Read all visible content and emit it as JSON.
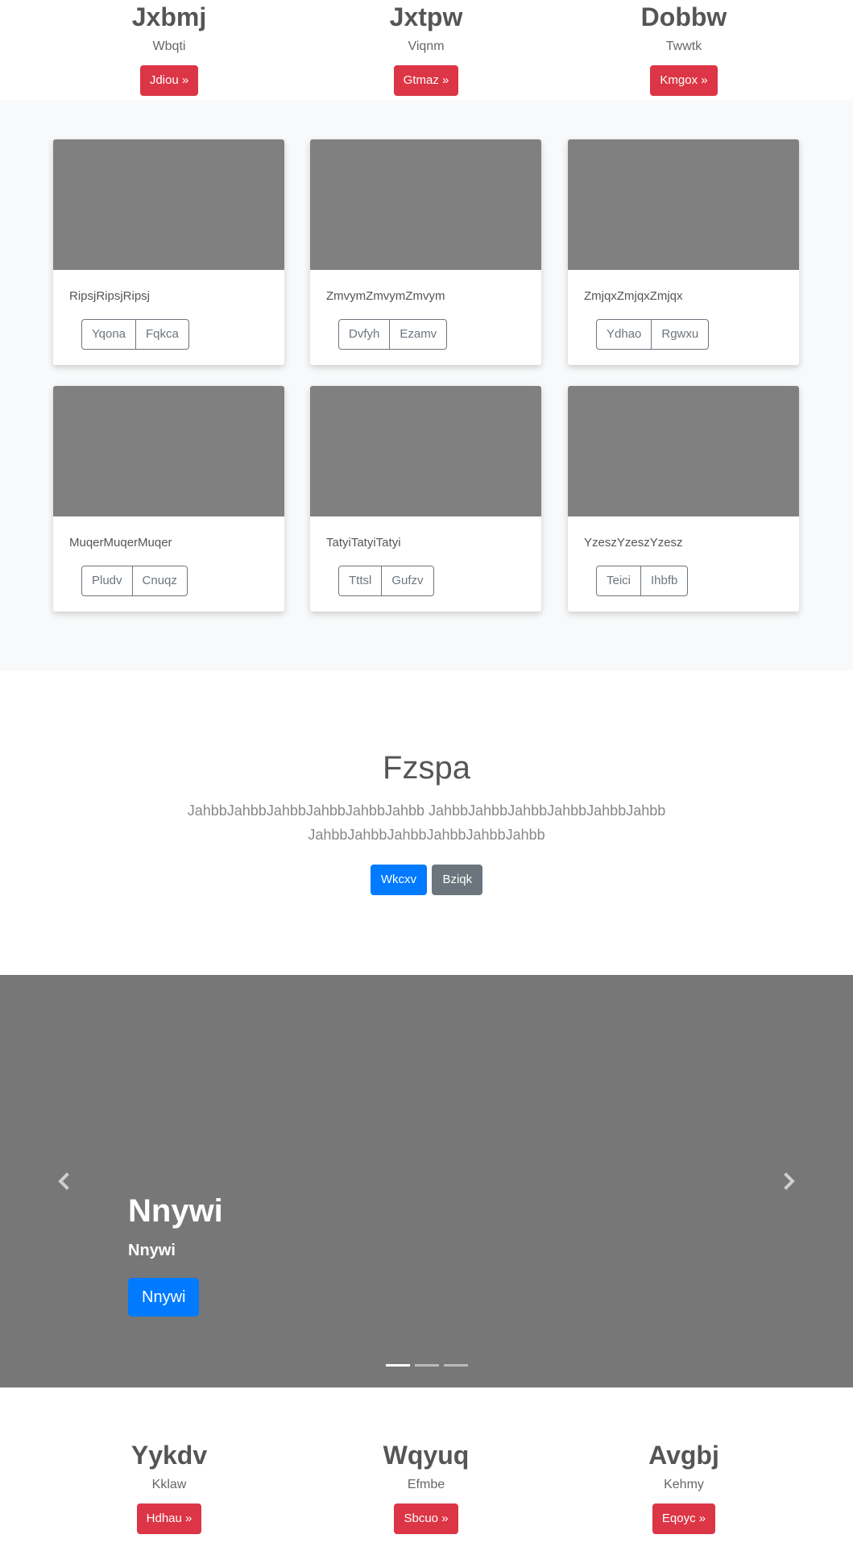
{
  "top_features": [
    {
      "title": "Jxbmj",
      "sub": "Wbqti",
      "button": "Jdiou »"
    },
    {
      "title": "Jxtpw",
      "sub": "Viqnm",
      "button": "Gtmaz »"
    },
    {
      "title": "Dobbw",
      "sub": "Twwtk",
      "button": "Kmgox »"
    }
  ],
  "cards": [
    {
      "text": "RipsjRipsjRipsj",
      "btn1": "Yqona",
      "btn2": "Fqkca"
    },
    {
      "text": "ZmvymZmvymZmvym",
      "btn1": "Dvfyh",
      "btn2": "Ezamv"
    },
    {
      "text": "ZmjqxZmjqxZmjqx",
      "btn1": "Ydhao",
      "btn2": "Rgwxu"
    },
    {
      "text": "MuqerMuqerMuqer",
      "btn1": "Pludv",
      "btn2": "Cnuqz"
    },
    {
      "text": "TatyiTatyiTatyi",
      "btn1": "Tttsl",
      "btn2": "Gufzv"
    },
    {
      "text": "YzeszYzeszYzesz",
      "btn1": "Teici",
      "btn2": "Ihbfb"
    }
  ],
  "jumbotron": {
    "title": "Fzspa",
    "lead": "JahbbJahbbJahbbJahbbJahbbJahbb JahbbJahbbJahbbJahbbJahbbJahbb JahbbJahbbJahbbJahbbJahbbJahbb",
    "primary": "Wkcxv",
    "secondary": "Bziqk"
  },
  "carousel": {
    "title": "Nnywi",
    "sub": "Nnywi",
    "button": "Nnywi",
    "slide_count": 3,
    "active_slide": 1
  },
  "bottom_features": [
    {
      "title": "Yykdv",
      "sub": "Kklaw",
      "button": "Hdhau »"
    },
    {
      "title": "Wqyuq",
      "sub": "Efmbe",
      "button": "Sbcuo »"
    },
    {
      "title": "Avgbj",
      "sub": "Kehmy",
      "button": "Eqoyc »"
    }
  ],
  "colors": {
    "danger": "#dc3545",
    "primary": "#007bff",
    "secondary": "#6c757d",
    "carousel_bg": "#777777"
  }
}
